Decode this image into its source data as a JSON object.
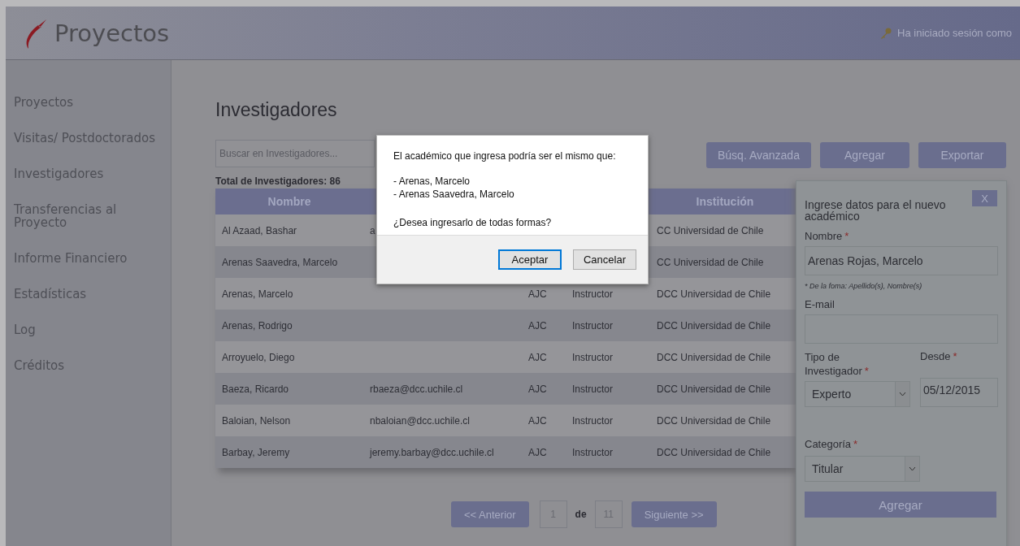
{
  "header": {
    "logo_text": "Proyectos",
    "login_text": "Ha iniciado sesión como"
  },
  "sidebar": {
    "items": [
      {
        "label": "Proyectos"
      },
      {
        "label": "Visitas/ Postdoctorados"
      },
      {
        "label": "Investigadores"
      },
      {
        "label": "Transferencias al Proyecto"
      },
      {
        "label": "Informe Financiero"
      },
      {
        "label": "Estadísticas"
      },
      {
        "label": "Log"
      },
      {
        "label": "Créditos"
      }
    ]
  },
  "page_title": "Investigadores",
  "search": {
    "placeholder": "Buscar en Investigadores..."
  },
  "toolbar": {
    "buttons": [
      "Búsq. Avanzada",
      "Agregar",
      "Exportar"
    ]
  },
  "total_label": "Total de Investigadores: 86",
  "table": {
    "columns": [
      "Nombre",
      "",
      "",
      "",
      "Institución"
    ],
    "rows": [
      [
        "Al Azaad, Bashar",
        "a",
        "",
        "",
        "CC Universidad de Chile"
      ],
      [
        "Arenas Saavedra, Marcelo",
        "",
        "",
        "",
        "CC Universidad de Chile"
      ],
      [
        "Arenas, Marcelo",
        "",
        "AJC",
        "Instructor",
        "DCC Universidad de Chile"
      ],
      [
        "Arenas, Rodrigo",
        "",
        "AJC",
        "Instructor",
        "DCC Universidad de Chile"
      ],
      [
        "Arroyuelo, Diego",
        "",
        "AJC",
        "Instructor",
        "DCC Universidad de Chile"
      ],
      [
        "Baeza, Ricardo",
        "rbaeza@dcc.uchile.cl",
        "AJC",
        "Instructor",
        "DCC Universidad de Chile"
      ],
      [
        "Baloian, Nelson",
        "nbaloian@dcc.uchile.cl",
        "AJC",
        "Instructor",
        "DCC Universidad de Chile"
      ],
      [
        "Barbay, Jeremy",
        "jeremy.barbay@dcc.uchile.cl",
        "AJC",
        "Instructor",
        "DCC Universidad de Chile"
      ]
    ]
  },
  "pagination": {
    "prev": "<< Anterior",
    "page": "1",
    "of": "de",
    "total": "11",
    "next": "Siguiente >>"
  },
  "dialog": {
    "message": "El académico que ingresa podría ser el mismo que:",
    "matches": [
      "- Arenas, Marcelo",
      "- Arenas Saavedra, Marcelo"
    ],
    "question": "¿Desea ingresarlo de todas formas?",
    "buttons": [
      {
        "label": "Aceptar",
        "selected": true
      },
      {
        "label": "Cancelar",
        "selected": false
      }
    ]
  },
  "side_panel": {
    "close": "X",
    "title": "Ingrese datos para el nuevo académico",
    "name": {
      "label": "Nombre",
      "required_mark": "*",
      "value": "Arenas Rojas, Marcelo",
      "hint": "* De la foma: Apellido(s), Nombre(s)"
    },
    "email": {
      "label": "E-mail"
    },
    "type": {
      "label": "Tipo de Investigador",
      "required_mark": "*",
      "value": "Experto"
    },
    "since": {
      "label": "Desde",
      "required_mark": "*",
      "value": "05/12/2015"
    },
    "category": {
      "label": "Categoría",
      "required_mark": "*",
      "value": "Titular"
    },
    "submit": "Agregar"
  }
}
